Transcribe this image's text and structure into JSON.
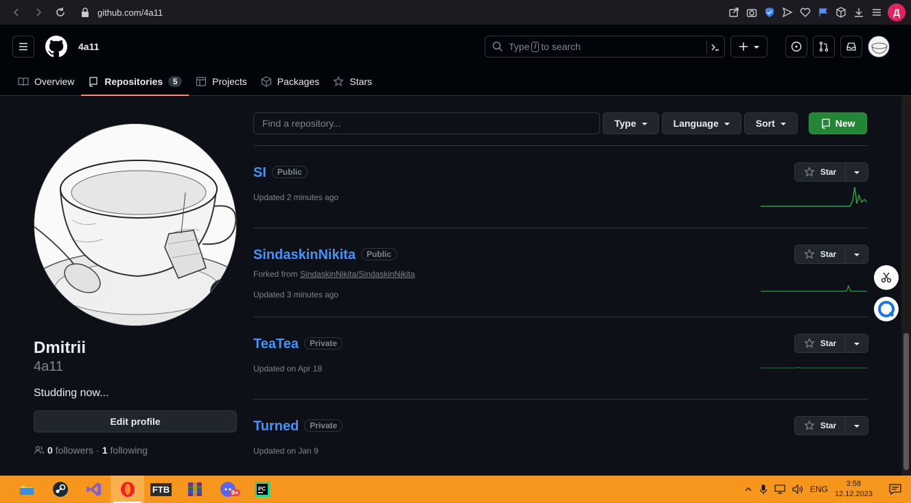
{
  "browser": {
    "url": "github.com/4a11",
    "profile_letter": "Д"
  },
  "header": {
    "username": "4a11",
    "search_placeholder_prefix": "Type",
    "search_key": "/",
    "search_placeholder_suffix": "to search"
  },
  "tabs": [
    {
      "label": "Overview",
      "icon": "book-icon"
    },
    {
      "label": "Repositories",
      "icon": "repo-icon",
      "count": "5"
    },
    {
      "label": "Projects",
      "icon": "table-icon"
    },
    {
      "label": "Packages",
      "icon": "package-icon"
    },
    {
      "label": "Stars",
      "icon": "star-icon"
    }
  ],
  "profile": {
    "name": "Dmitrii",
    "login": "4a11",
    "bio": "Studding now...",
    "edit_label": "Edit profile",
    "followers_count": "0",
    "followers_label": "followers",
    "separator": "·",
    "following_count": "1",
    "following_label": "following"
  },
  "filters": {
    "find_placeholder": "Find a repository...",
    "type_label": "Type",
    "language_label": "Language",
    "sort_label": "Sort",
    "new_label": "New"
  },
  "repos": [
    {
      "name": "SI",
      "visibility": "Public",
      "forked_prefix": "",
      "forked_from": "",
      "updated": "Updated 2 minutes ago",
      "star_label": "Star"
    },
    {
      "name": "SindaskinNikita",
      "visibility": "Public",
      "forked_prefix": "Forked from",
      "forked_from": "SindaskinNikita/SindaskinNikita",
      "updated": "Updated 3 minutes ago",
      "star_label": "Star"
    },
    {
      "name": "TeaTea",
      "visibility": "Private",
      "forked_prefix": "",
      "forked_from": "",
      "updated": "Updated on Apr 18",
      "star_label": "Star"
    },
    {
      "name": "Turned",
      "visibility": "Private",
      "forked_prefix": "",
      "forked_from": "",
      "updated": "Updated on Jan 9",
      "star_label": "Star"
    }
  ],
  "taskbar": {
    "ftb_label": "FTB",
    "badge": "9+",
    "lang": "ENG",
    "time": "3:58",
    "date": "12.12.2023"
  },
  "colors": {
    "link": "#4493f8",
    "new_button": "#238636",
    "active_tab_underline": "#fd8c73",
    "taskbar": "#f7961c"
  }
}
